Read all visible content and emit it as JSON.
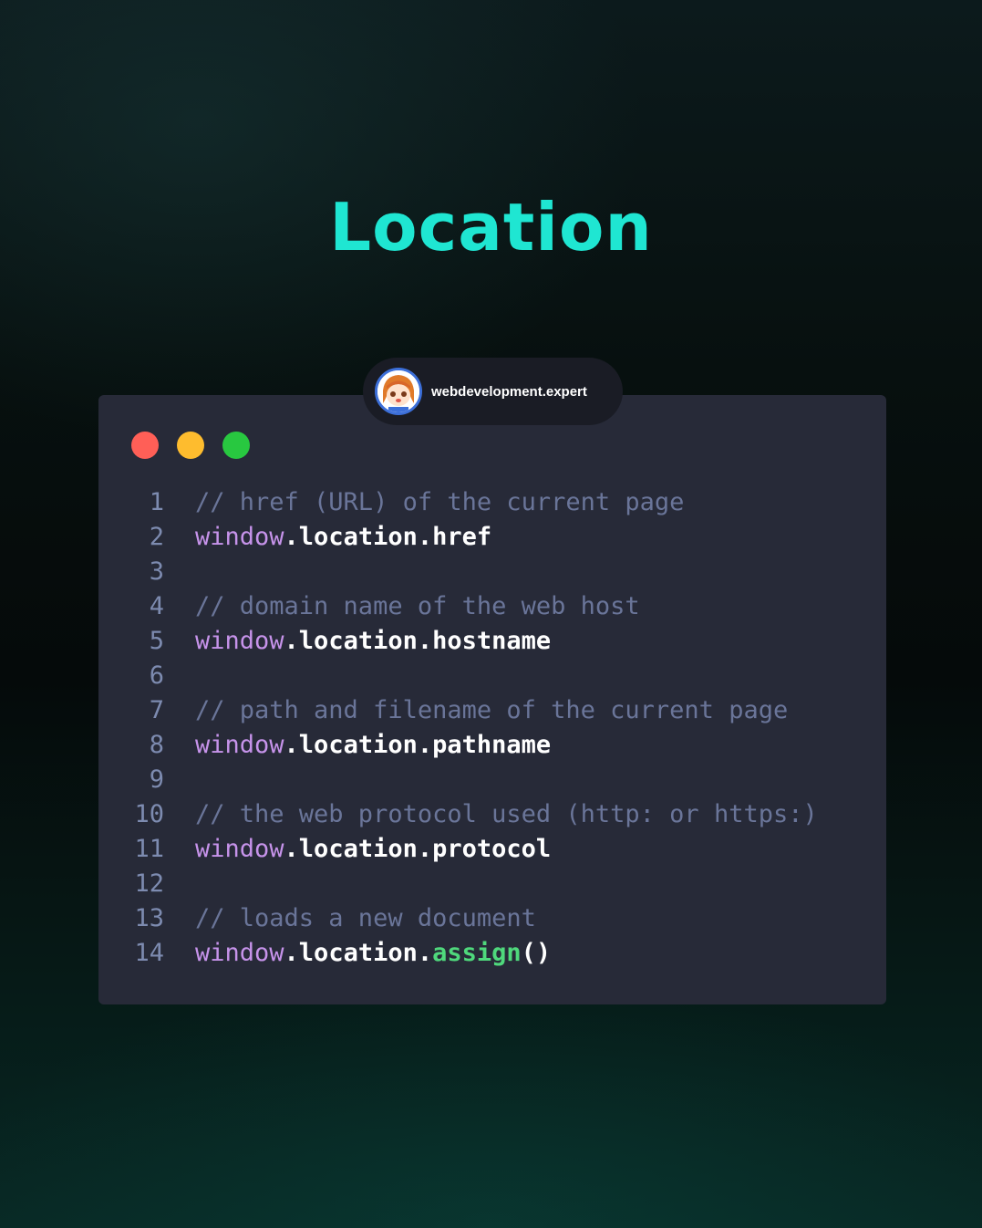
{
  "title": "Location",
  "badge": {
    "handle": "webdevelopment.expert",
    "avatar_icon": "anime-avatar-icon"
  },
  "window_controls": {
    "close_color": "#ff5f57",
    "minimize_color": "#febc2e",
    "maximize_color": "#28c840"
  },
  "colors": {
    "title": "#1fe6d2",
    "card": "#272a38",
    "comment": "#6a7599",
    "object": "#c693ea",
    "property": "#ffffff",
    "method": "#4fd87c",
    "line_number": "#7d8bb0"
  },
  "code_lines": [
    {
      "n": "1",
      "comment": "// href (URL) of the current page"
    },
    {
      "n": "2",
      "obj": "window",
      "rest": ".location.href",
      "method": "",
      "tail": ""
    },
    {
      "n": "3"
    },
    {
      "n": "4",
      "comment": "// domain name of the web host"
    },
    {
      "n": "5",
      "obj": "window",
      "rest": ".location.hostname",
      "method": "",
      "tail": ""
    },
    {
      "n": "6"
    },
    {
      "n": "7",
      "comment": "// path and filename of the current page"
    },
    {
      "n": "8",
      "obj": "window",
      "rest": ".location.pathname",
      "method": "",
      "tail": ""
    },
    {
      "n": "9"
    },
    {
      "n": "10",
      "comment": "// the web protocol used (http: or https:)"
    },
    {
      "n": "11",
      "obj": "window",
      "rest": ".location.protocol",
      "method": "",
      "tail": ""
    },
    {
      "n": "12"
    },
    {
      "n": "13",
      "comment": "// loads a new document"
    },
    {
      "n": "14",
      "obj": "window",
      "rest": ".location.",
      "method": "assign",
      "tail": "()"
    }
  ]
}
